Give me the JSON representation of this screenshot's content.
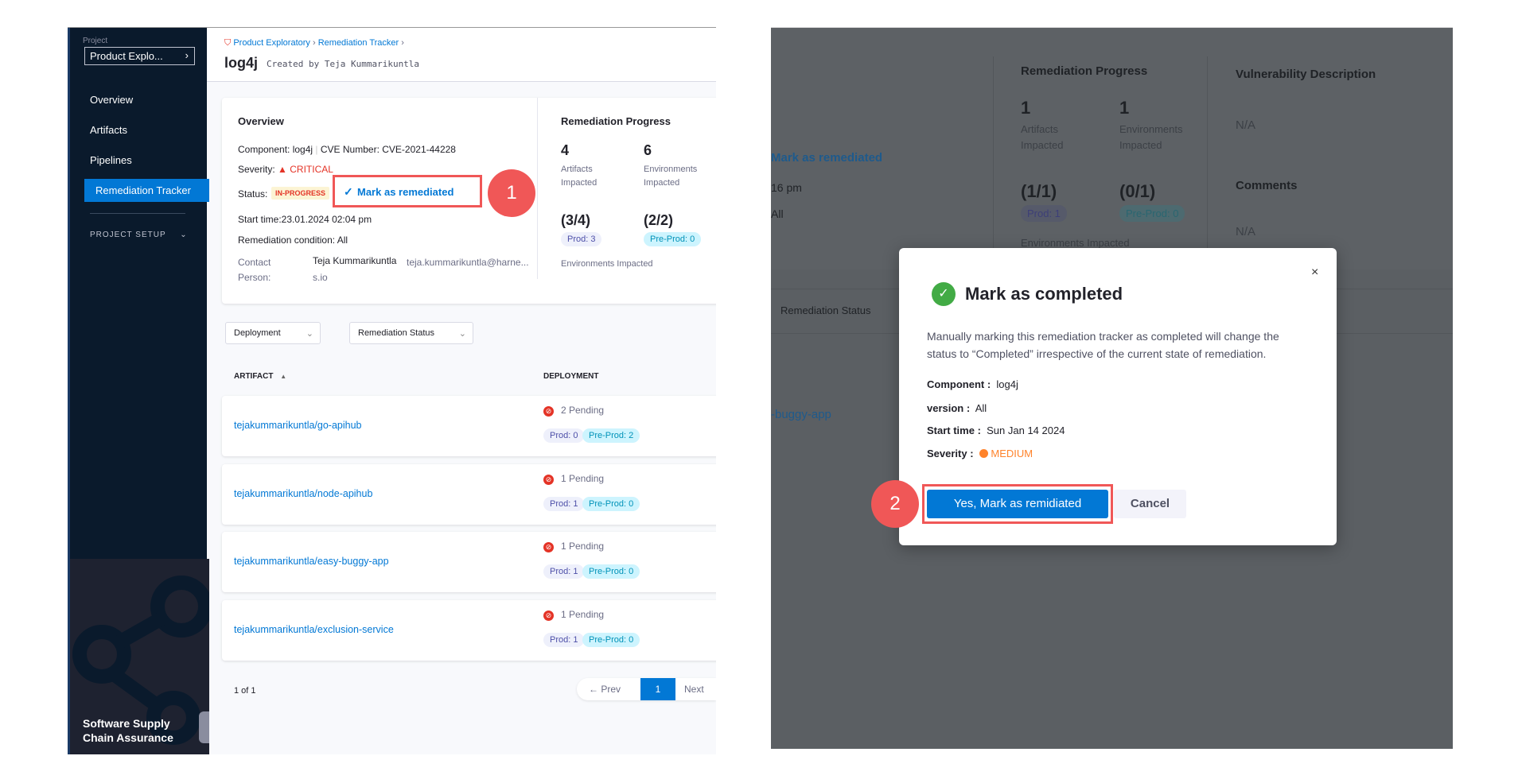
{
  "left_panel": {
    "sidebar": {
      "project_label": "Project",
      "project_name": "Product Explo...",
      "items": [
        {
          "label": "Overview"
        },
        {
          "label": "Artifacts"
        },
        {
          "label": "Pipelines"
        },
        {
          "label": "Remediation Tracker",
          "active": true
        }
      ],
      "project_setup": "PROJECT SETUP",
      "module_name_line1": "Software Supply",
      "module_name_line2": "Chain Assurance"
    },
    "breadcrumb": [
      "Product Exploratory",
      "Remediation Tracker"
    ],
    "title": "log4j",
    "created_by": "Created by Teja Kummarikuntla",
    "overview": {
      "heading": "Overview",
      "component_label": "Component:",
      "component": "log4j",
      "cve_label": "CVE Number:",
      "cve": "CVE-2021-44228",
      "severity_label": "Severity:",
      "severity": "CRITICAL",
      "status_label": "Status:",
      "status": "IN-PROGRESS",
      "mark_button": "Mark as remediated",
      "start_time": "Start time:23.01.2024 02:04 pm",
      "condition_label": "Remediation condition:",
      "condition": "All",
      "contact_label_1": "Contact",
      "contact_label_2": "Person:",
      "contact_name": "Teja Kummarikuntla",
      "contact_email_1": "teja.kummarikuntla@harne...",
      "contact_email_2": "s.io"
    },
    "progress": {
      "heading": "Remediation Progress",
      "artifacts_count": "4",
      "artifacts_label_1": "Artifacts",
      "artifacts_label_2": "Impacted",
      "env_count": "6",
      "env_label_1": "Environments",
      "env_label_2": "Impacted",
      "ratio_1": "(3/4)",
      "pill_1": "Prod: 3",
      "ratio_2": "(2/2)",
      "pill_2": "Pre-Prod: 0",
      "footer": "Environments Impacted"
    },
    "step_1": "1",
    "filters": {
      "deployment": "Deployment",
      "status": "Remediation Status"
    },
    "table": {
      "col_artifact": "ARTIFACT",
      "col_deployment": "DEPLOYMENT",
      "rows": [
        {
          "artifact": "tejakummarikuntla/go-apihub",
          "pending": "2 Pending",
          "prod": "Prod: 0",
          "preprod": "Pre-Prod: 2"
        },
        {
          "artifact": "tejakummarikuntla/node-apihub",
          "pending": "1 Pending",
          "prod": "Prod: 1",
          "preprod": "Pre-Prod: 0"
        },
        {
          "artifact": "tejakummarikuntla/easy-buggy-app",
          "pending": "1 Pending",
          "prod": "Prod: 1",
          "preprod": "Pre-Prod: 0"
        },
        {
          "artifact": "tejakummarikuntla/exclusion-service",
          "pending": "1 Pending",
          "prod": "Prod: 1",
          "preprod": "Pre-Prod: 0"
        }
      ]
    },
    "pagination": {
      "summary": "1 of 1",
      "prev": "← Prev",
      "page": "1",
      "next": "Next"
    }
  },
  "right_panel": {
    "bg": {
      "mark_partial": "Mark as remediated",
      "time_partial": "16 pm",
      "all_partial": "All",
      "progress_heading": "Remediation Progress",
      "artifacts_count": "1",
      "artifacts_label_1": "Artifacts",
      "artifacts_label_2": "Impacted",
      "env_count": "1",
      "env_label_1": "Environments",
      "env_label_2": "Impacted",
      "ratio_1": "(1/1)",
      "pill_1": "Prod: 1",
      "ratio_2": "(0/1)",
      "pill_2": "Pre-Prod: 0",
      "footer": "Environments Impacted",
      "vuln_heading": "Vulnerability Description",
      "vuln_value": "N/A",
      "comments_heading": "Comments",
      "comments_value": "N/A",
      "col_status": "Remediation Status",
      "artifact_partial": "-buggy-app"
    },
    "modal": {
      "title": "Mark as completed",
      "description_1": "Manually marking this remediation tracker as completed will change the",
      "description_2": "status to “Completed” irrespective of the current state of remediation.",
      "component_label": "Component :",
      "component": "log4j",
      "version_label": "version :",
      "version": "All",
      "start_label": "Start time :",
      "start": "Sun Jan 14 2024",
      "severity_label": "Severity :",
      "severity": "MEDIUM",
      "confirm": "Yes, Mark as remidiated",
      "cancel": "Cancel"
    },
    "step_2": "2"
  },
  "colors": {
    "accent": "#0278d5",
    "callout": "#f05757",
    "critical": "#e43326",
    "medium": "#ff832b",
    "success": "#42ab45"
  }
}
